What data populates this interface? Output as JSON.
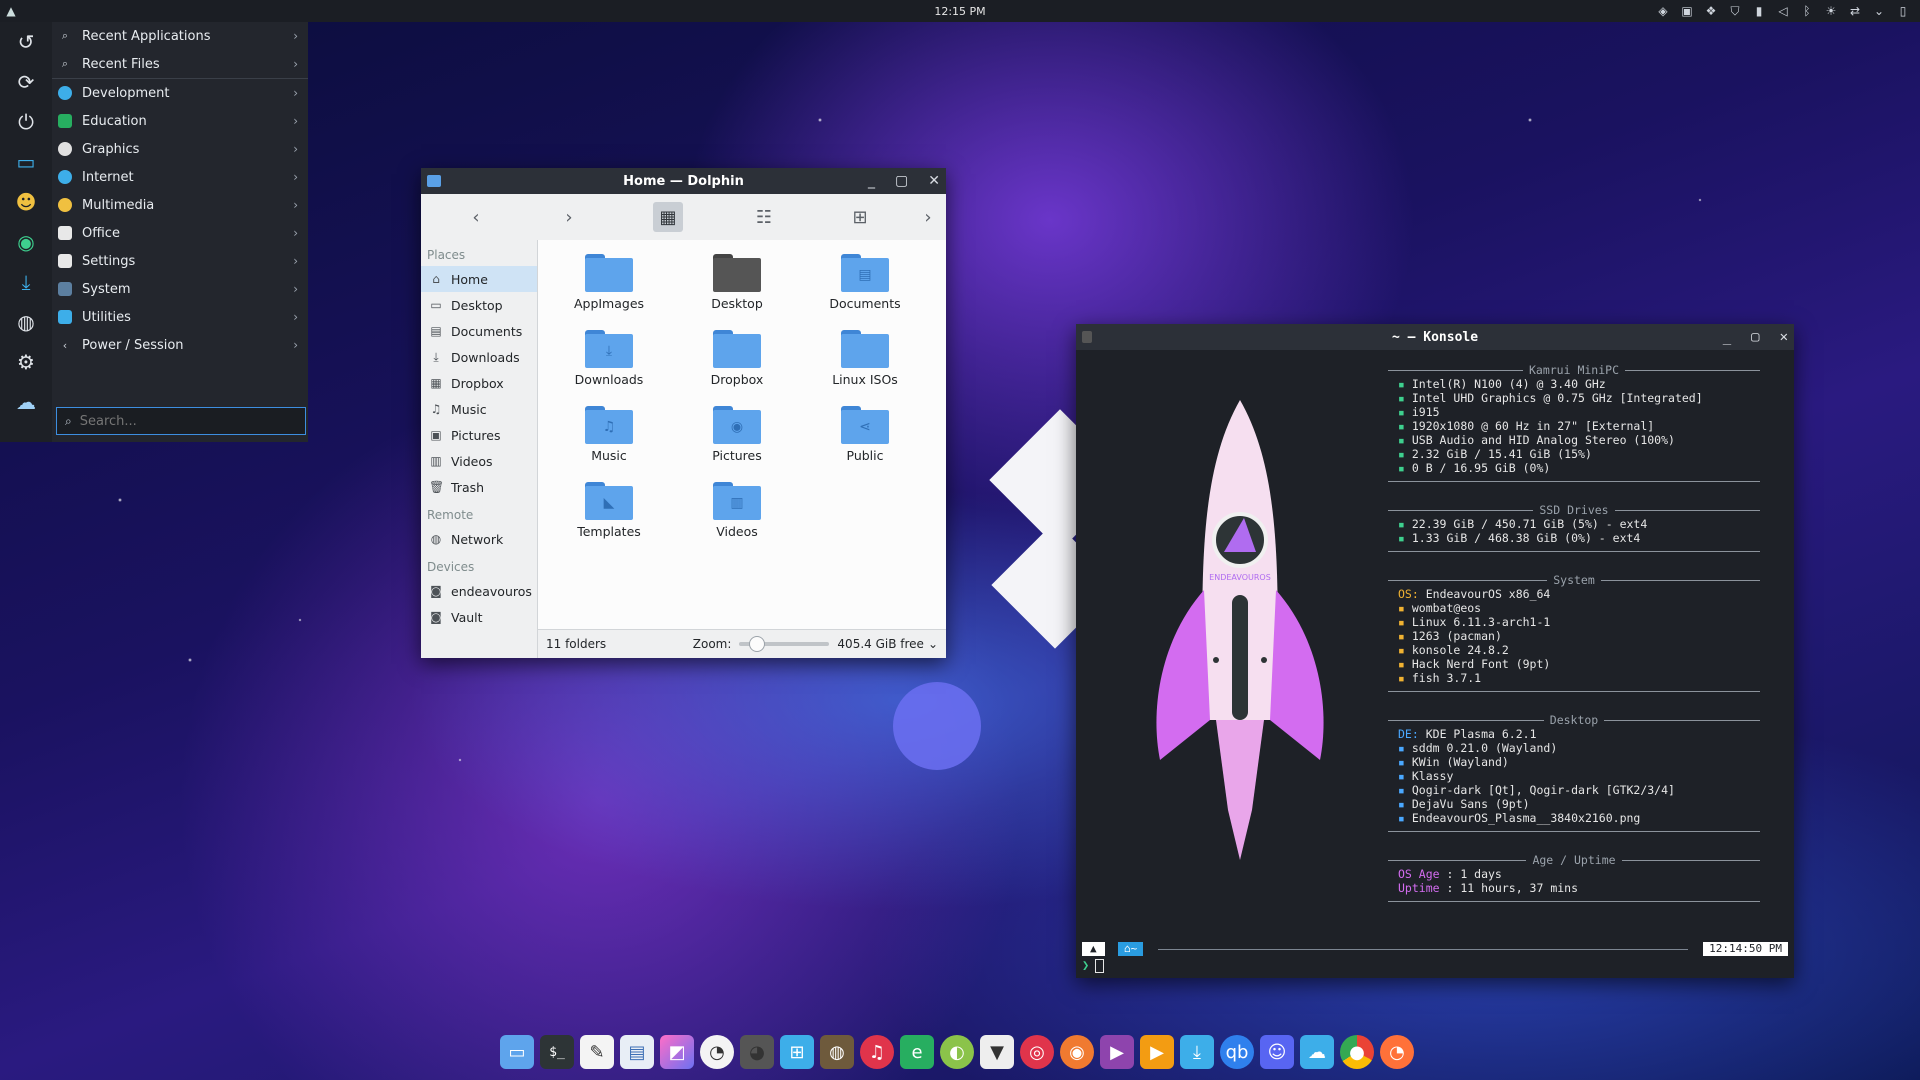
{
  "topbar": {
    "clock": "12:15 PM",
    "tray_icons": [
      "shield-icon",
      "window-icon",
      "dropbox-icon",
      "vpn-icon",
      "clipboard-icon",
      "volume-icon",
      "bluetooth-icon",
      "brightness-icon",
      "network-icon",
      "chevron-down-icon",
      "desktop-icon"
    ]
  },
  "launcher": {
    "favorites": [
      "back-icon",
      "refresh-icon",
      "power-icon",
      "toggle-icon",
      "avatar-icon",
      "app-icon",
      "download-icon",
      "gimp-icon",
      "settings-icon",
      "cloud-icon"
    ],
    "items": [
      {
        "label": "Recent Applications",
        "icon": "search-icon",
        "color": "#c9cfd6"
      },
      {
        "label": "Recent Files",
        "icon": "search-icon",
        "color": "#c9cfd6"
      },
      {
        "label": "Development",
        "icon": "development-icon",
        "color": "#3daee9"
      },
      {
        "label": "Education",
        "icon": "education-icon",
        "color": "#27ae60"
      },
      {
        "label": "Graphics",
        "icon": "graphics-icon",
        "color": "#e0e0e0"
      },
      {
        "label": "Internet",
        "icon": "internet-icon",
        "color": "#3daee9"
      },
      {
        "label": "Multimedia",
        "icon": "multimedia-icon",
        "color": "#f0c040"
      },
      {
        "label": "Office",
        "icon": "office-icon",
        "color": "#e8e8e8"
      },
      {
        "label": "Settings",
        "icon": "settings-icon",
        "color": "#e8e8e8"
      },
      {
        "label": "System",
        "icon": "system-icon",
        "color": "#5c7fa0"
      },
      {
        "label": "Utilities",
        "icon": "utilities-icon",
        "color": "#3daee9"
      },
      {
        "label": "Power / Session",
        "icon": "chevron-left-icon",
        "color": "#c9cfd6"
      }
    ],
    "search_placeholder": "Search..."
  },
  "dolphin": {
    "title": "Home — Dolphin",
    "places_header": "Places",
    "places": [
      "Home",
      "Desktop",
      "Documents",
      "Downloads",
      "Dropbox",
      "Music",
      "Pictures",
      "Videos",
      "Trash"
    ],
    "remote_header": "Remote",
    "remote": [
      "Network"
    ],
    "devices_header": "Devices",
    "devices": [
      "endeavouros",
      "Vault"
    ],
    "folders": [
      "AppImages",
      "Desktop",
      "Documents",
      "Downloads",
      "Dropbox",
      "Linux ISOs",
      "Music",
      "Pictures",
      "Public",
      "Templates",
      "Videos"
    ],
    "status": {
      "count": "11 folders",
      "zoom_label": "Zoom:",
      "free": "405.4 GiB free"
    }
  },
  "konsole": {
    "title": "~ — Konsole",
    "sections": [
      {
        "header": "Kamrui MiniPC",
        "lines": [
          "Intel(R) N100 (4) @ 3.40 GHz",
          "Intel UHD Graphics @ 0.75 GHz [Integrated]",
          "i915",
          "1920x1080 @ 60 Hz in 27\" [External]",
          "USB Audio and HID Analog Stereo (100%)",
          "2.32 GiB / 15.41 GiB (15%)",
          "0 B / 16.95 GiB (0%)"
        ]
      },
      {
        "header": "SSD Drives",
        "lines": [
          "22.39 GiB / 450.71 GiB (5%) - ext4",
          "1.33 GiB / 468.38 GiB (0%) - ext4"
        ]
      },
      {
        "header": "System",
        "lines": [
          "EndeavourOS x86_64",
          "wombat@eos",
          "Linux 6.11.3-arch1-1",
          "1263 (pacman)",
          "konsole 24.8.2",
          "Hack Nerd Font (9pt)",
          "fish 3.7.1"
        ]
      },
      {
        "header": "Desktop",
        "lines": [
          "KDE Plasma 6.2.1",
          "sddm 0.21.0 (Wayland)",
          "KWin (Wayland)",
          "Klassy",
          "Qogir-dark [Qt], Qogir-dark [GTK2/3/4]",
          "DejaVu Sans (9pt)",
          "EndeavourOS_Plasma__3840x2160.png"
        ]
      },
      {
        "header": "Age / Uptime",
        "lines": [
          "OS Age : 1 days",
          "Uptime : 11 hours, 37 mins"
        ]
      }
    ],
    "os_prefix": "OS:",
    "de_prefix": "DE:",
    "os_age_label": "OS Age",
    "os_age_value": " : 1 days",
    "uptime_label": "Uptime",
    "uptime_value": " : 11 hours, 37 mins",
    "prompt_time": "12:14:50 PM",
    "logo_text": "ENDEAVOUROS"
  },
  "taskbar": [
    "files-icon",
    "terminal-icon",
    "text-editor-icon",
    "document-icon",
    "image-viewer-icon",
    "clock-icon",
    "cat-icon",
    "remote-icon",
    "gimp-icon",
    "headphones-icon",
    "ereader-icon",
    "disc-icon",
    "wolf-icon",
    "target-icon",
    "camera-icon",
    "video-icon",
    "player-icon",
    "download-icon",
    "qbittorrent-icon",
    "discord-icon",
    "cloud-icon",
    "chrome-icon",
    "firefox-icon"
  ],
  "colors": {
    "accent": "#3d8ee0",
    "folder": "#5ea4ec",
    "terminal_green": "#3ecf8e",
    "terminal_red": "#ff5555"
  }
}
